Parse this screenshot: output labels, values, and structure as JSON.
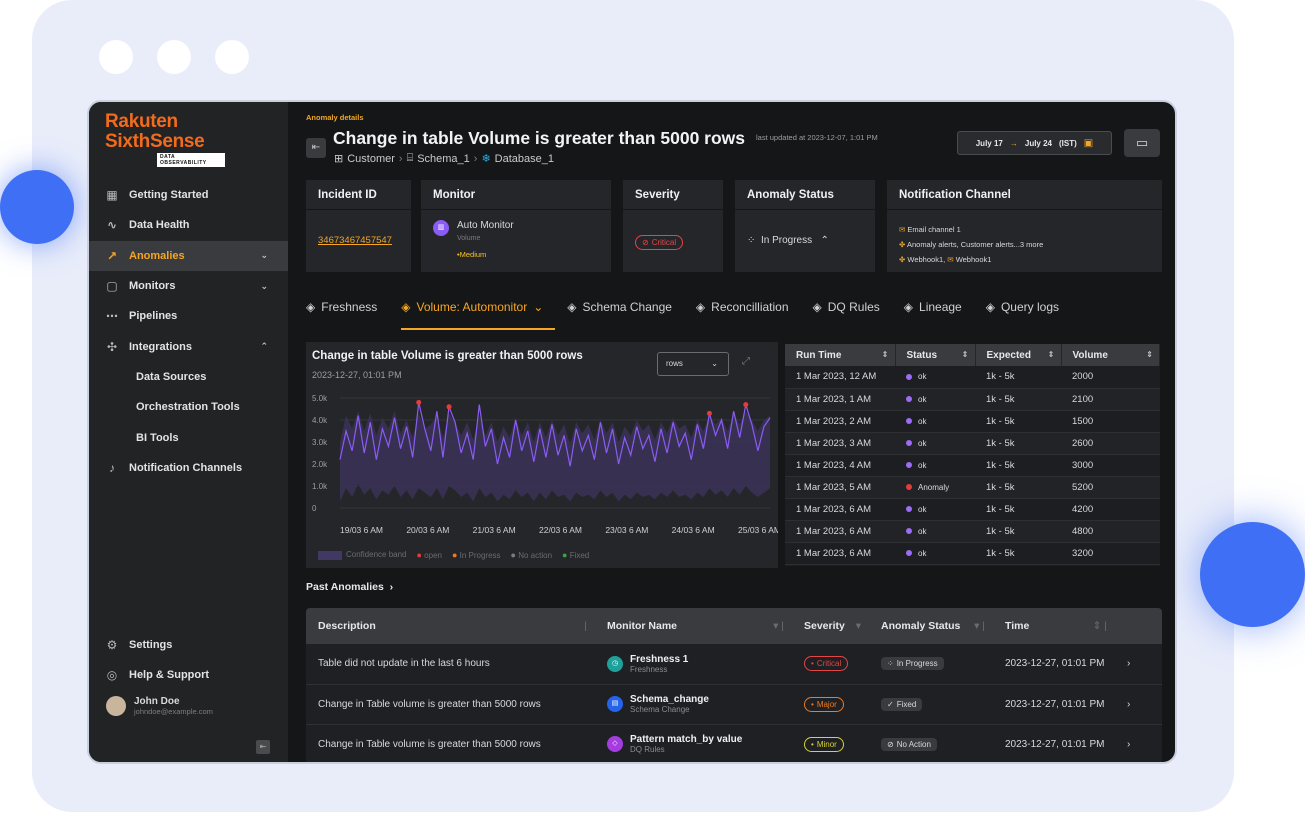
{
  "sidebar": {
    "logo_line1": "Rakuten",
    "logo_line2": "SixthSense",
    "logo_tag": "DATA OBSERVABILITY",
    "items": [
      {
        "label": "Getting Started",
        "icon": "grid-icon"
      },
      {
        "label": "Data Health",
        "icon": "pulse-icon"
      },
      {
        "label": "Anomalies",
        "icon": "trend-icon",
        "chev": "⌄"
      },
      {
        "label": "Monitors",
        "icon": "monitor-icon",
        "chev": "⌄"
      },
      {
        "label": "Pipelines",
        "icon": "pipeline-icon"
      },
      {
        "label": "Integrations",
        "icon": "puzzle-icon",
        "chev": "⌃"
      },
      {
        "label": "Data Sources"
      },
      {
        "label": "Orchestration Tools"
      },
      {
        "label": "BI Tools"
      },
      {
        "label": "Notification Channels",
        "icon": "bell-icon"
      }
    ],
    "settings": "Settings",
    "help": "Help & Support",
    "user_name": "John Doe",
    "user_email": "johndoe@example.com"
  },
  "header": {
    "small": "Anomaly details",
    "title": "Change in table Volume is greater than 5000 rows",
    "updated": "last updated at 2023-12-07, 1:01 PM",
    "path": [
      "Customer",
      "Schema_1",
      "Database_1"
    ],
    "date_from": "July 17",
    "date_to": "July 24",
    "tz": "(IST)"
  },
  "cards": {
    "incident_h": "Incident ID",
    "incident_id": "34673467457547",
    "monitor_h": "Monitor",
    "monitor_name": "Auto Monitor",
    "monitor_sub": "Volume",
    "monitor_level": "•Medium",
    "severity_h": "Severity",
    "severity": "Critical",
    "status_h": "Anomaly Status",
    "status": "In Progress",
    "notif_h": "Notification Channel",
    "notif1": "Email channel 1",
    "notif2": "Anomaly alerts, Customer alerts...3 more",
    "notif3a": "Webhook1,",
    "notif3b": "Webhook1"
  },
  "tabs": [
    "Freshness",
    "Volume: Automonitor",
    "Schema Change",
    "Reconcilliation",
    "DQ Rules",
    "Lineage",
    "Query logs"
  ],
  "chart": {
    "title": "Change in table Volume is greater than 5000 rows",
    "subtitle": "2023-12-27, 01:01 PM",
    "select": "rows",
    "legend": [
      "Confidence band",
      "open",
      "In Progress",
      "No action",
      "Fixed"
    ]
  },
  "chart_data": {
    "type": "line",
    "x": [
      "19/03 6 AM",
      "20/03 6 AM",
      "21/03 6 AM",
      "22/03 6 AM",
      "23/03 6 AM",
      "24/03 6 AM",
      "25/03 6 AM"
    ],
    "yticks": [
      "5.0k",
      "4.0k",
      "3.0k",
      "2.0k",
      "1.0k",
      "0"
    ],
    "ylim": [
      0,
      5000
    ],
    "series": [
      {
        "values": [
          2200,
          3500,
          2600,
          4200,
          2500,
          3900,
          2200,
          3600,
          2800,
          4100,
          2700,
          3700,
          2300,
          4800,
          3600,
          2600,
          4400,
          2300,
          4600,
          3900,
          2500,
          3400,
          2200,
          4700,
          2800,
          3600,
          2000,
          3200,
          2300,
          4000,
          2600,
          3500,
          2100,
          3600,
          2300,
          3800,
          2400,
          3300,
          1900,
          3600,
          2600,
          3300,
          2200,
          3900,
          2500,
          3600,
          2000,
          3200,
          2400,
          3700,
          2700,
          3300,
          2100,
          3600,
          2500,
          3900,
          2800,
          3400,
          2200,
          3800,
          2700,
          4300,
          3300,
          4000,
          2700,
          4400,
          3200,
          4700,
          3800,
          2600,
          3700,
          4100
        ]
      }
    ],
    "band_upper": [
      3000,
      4200,
      3600,
      4400,
      3500,
      4300,
      3300,
      4100,
      3600,
      4400,
      3400,
      4000,
      3200,
      4300,
      3600,
      3800,
      4200,
      3200,
      4300,
      3900,
      3300,
      3900,
      3100,
      4200,
      3300,
      3900,
      3000,
      3700,
      3200,
      4100,
      3300,
      3900,
      3000,
      3900,
      3200,
      4000,
      3300,
      3800,
      2900,
      3900,
      3400,
      3800,
      3100,
      4000,
      3400,
      3900,
      3000,
      3700,
      3300,
      4000,
      3500,
      3800,
      3100,
      3900,
      3400,
      4100,
      3600,
      3800,
      3200,
      4000,
      3500,
      4200,
      3800,
      4100,
      3500,
      4300,
      3800,
      4400,
      4000,
      3500,
      4000,
      4200
    ],
    "band_lower": [
      300,
      900,
      500,
      1100,
      600,
      900,
      400,
      800,
      600,
      1000,
      500,
      800,
      400,
      900,
      700,
      500,
      900,
      400,
      1000,
      800,
      500,
      700,
      300,
      900,
      500,
      700,
      300,
      600,
      400,
      800,
      500,
      700,
      300,
      700,
      400,
      800,
      500,
      600,
      300,
      700,
      500,
      600,
      400,
      800,
      500,
      700,
      300,
      600,
      400,
      700,
      500,
      600,
      400,
      700,
      500,
      800,
      500,
      600,
      400,
      700,
      500,
      900,
      600,
      800,
      500,
      900,
      600,
      1000,
      700,
      500,
      700,
      900
    ],
    "anomalies": [
      {
        "index": 13,
        "value": 4800
      },
      {
        "index": 18,
        "value": 4600
      },
      {
        "index": 61,
        "value": 4300
      },
      {
        "index": 67,
        "value": 4700
      }
    ]
  },
  "runs": {
    "headers": [
      "Run Time",
      "Status",
      "Expected",
      "Volume"
    ],
    "rows": [
      {
        "time": "1 Mar 2023, 12 AM",
        "status": "ok",
        "expected": "1k - 5k",
        "volume": "2000"
      },
      {
        "time": "1 Mar 2023, 1 AM",
        "status": "ok",
        "expected": "1k - 5k",
        "volume": "2100"
      },
      {
        "time": "1 Mar 2023, 2 AM",
        "status": "ok",
        "expected": "1k - 5k",
        "volume": "1500"
      },
      {
        "time": "1 Mar 2023, 3 AM",
        "status": "ok",
        "expected": "1k - 5k",
        "volume": "2600"
      },
      {
        "time": "1 Mar 2023, 4 AM",
        "status": "ok",
        "expected": "1k - 5k",
        "volume": "3000"
      },
      {
        "time": "1 Mar 2023, 5 AM",
        "status": "Anomaly",
        "expected": "1k - 5k",
        "volume": "5200"
      },
      {
        "time": "1 Mar 2023, 6 AM",
        "status": "ok",
        "expected": "1k - 5k",
        "volume": "4200"
      },
      {
        "time": "1 Mar 2023, 6 AM",
        "status": "ok",
        "expected": "1k - 5k",
        "volume": "4800"
      },
      {
        "time": "1 Mar 2023, 6 AM",
        "status": "ok",
        "expected": "1k - 5k",
        "volume": "3200"
      }
    ]
  },
  "past": {
    "label": "Past Anomalies",
    "headers": [
      "Description",
      "Monitor Name",
      "Severity",
      "Anomaly Status",
      "Time"
    ],
    "rows": [
      {
        "desc": "Table did not update in the last 6 hours",
        "mon": "Freshness 1",
        "monsub": "Freshness",
        "sev": "Critical",
        "status": "In Progress",
        "time": "2023-12-27, 01:01 PM"
      },
      {
        "desc": "Change in Table volume is greater than 5000 rows",
        "mon": "Schema_change",
        "monsub": "Schema Change",
        "sev": "Major",
        "status": "Fixed",
        "time": "2023-12-27, 01:01 PM"
      },
      {
        "desc": "Change in Table volume is greater than 5000 rows",
        "mon": "Pattern match_by value",
        "monsub": "DQ Rules",
        "sev": "Minor",
        "status": "No Action",
        "time": "2023-12-27, 01:01 PM"
      }
    ]
  },
  "colors": {
    "accent": "#f5a623",
    "ok": "#9b6cf5",
    "anomaly": "#e53b3b",
    "line": "#8a5cf5",
    "band": "#3b3358"
  }
}
